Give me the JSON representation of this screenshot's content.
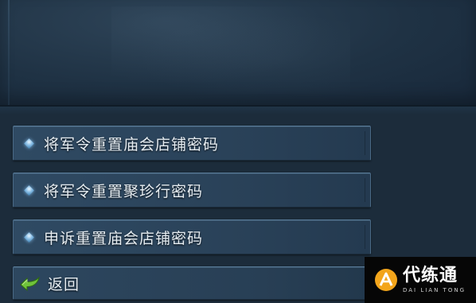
{
  "menu": {
    "items": [
      {
        "label": "将军令重置庙会店铺密码",
        "icon": "diamond-bullet-icon"
      },
      {
        "label": "将军令重置聚珍行密码",
        "icon": "diamond-bullet-icon"
      },
      {
        "label": "申诉重置庙会店铺密码",
        "icon": "diamond-bullet-icon"
      }
    ],
    "back": {
      "label": "返回",
      "icon": "green-back-arrow-icon"
    }
  },
  "watermark": {
    "name": "代练通",
    "subtitle": "DAI LIAN TONG"
  },
  "colors": {
    "background": "#1c2c3b",
    "option_bg": "#2f4a63",
    "option_border": "#4a6a86",
    "text": "#e6edf2",
    "bullet": "#8fc2e8",
    "back_arrow": "#6fc23a",
    "logo_accent": "#f3a51b"
  }
}
